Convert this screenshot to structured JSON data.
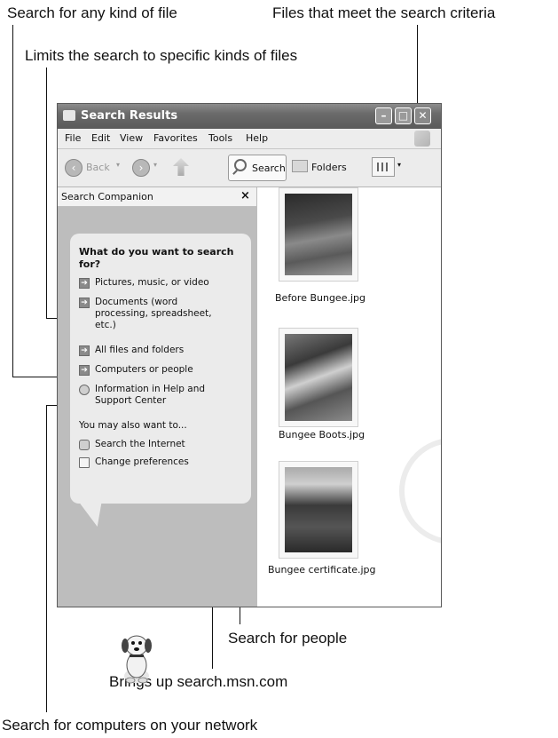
{
  "callouts": {
    "search_any_file": "Search for any kind of file",
    "files_meet_criteria": "Files that meet the search criteria",
    "limits_search": "Limits the search to specific kinds of files",
    "search_people": "Search for people",
    "brings_up_msn": "Brings up search.msn.com",
    "search_computers": "Search for computers on your network"
  },
  "window": {
    "title": "Search Results",
    "menu": [
      "File",
      "Edit",
      "View",
      "Favorites",
      "Tools",
      "Help"
    ],
    "toolbar": {
      "back_label": "Back",
      "search_label": "Search",
      "folders_label": "Folders"
    }
  },
  "search_pane": {
    "header": "Search Companion",
    "question": "What do you want to search for?",
    "options": [
      "Pictures, music, or video",
      "Documents (word processing, spreadsheet, etc.)",
      "All files and folders",
      "Computers or people",
      "Information in Help and Support Center"
    ],
    "also_heading": "You may also want to...",
    "also_options": [
      "Search the Internet",
      "Change preferences"
    ]
  },
  "results": [
    {
      "name": "Before Bungee.jpg"
    },
    {
      "name": "Bungee Boots.jpg"
    },
    {
      "name": "Bungee certificate.jpg"
    }
  ]
}
